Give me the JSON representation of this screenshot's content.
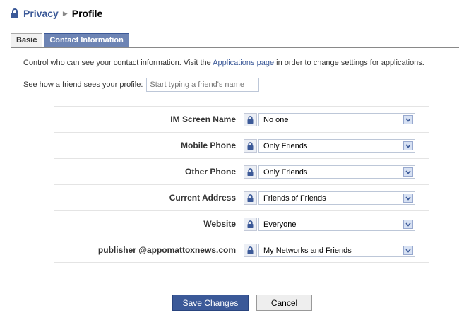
{
  "breadcrumb": {
    "parent": "Privacy",
    "separator": "▶",
    "current": "Profile"
  },
  "tabs": [
    {
      "label": "Basic",
      "active": false
    },
    {
      "label": "Contact Information",
      "active": true
    }
  ],
  "intro": {
    "text_before": "Control who can see your contact information. Visit the ",
    "link": "Applications page",
    "text_after": " in order to change settings for applications."
  },
  "preview": {
    "label": "See how a friend sees your profile:",
    "placeholder": "Start typing a friend's name"
  },
  "settings": [
    {
      "label": "IM Screen Name",
      "value": "No one"
    },
    {
      "label": "Mobile Phone",
      "value": "Only Friends"
    },
    {
      "label": "Other Phone",
      "value": "Only Friends"
    },
    {
      "label": "Current Address",
      "value": "Friends of Friends"
    },
    {
      "label": "Website",
      "value": "Everyone"
    },
    {
      "label": "publisher @appomattoxnews.com",
      "value": "My Networks and Friends"
    }
  ],
  "actions": {
    "save": "Save Changes",
    "cancel": "Cancel"
  },
  "colors": {
    "link": "#3b5998",
    "active_tab": "#6d84b4",
    "save_button": "#3b5998",
    "lock": "#3b5998"
  },
  "icons": {
    "lock": "lock-icon",
    "dropdown": "chevron-down-icon"
  }
}
